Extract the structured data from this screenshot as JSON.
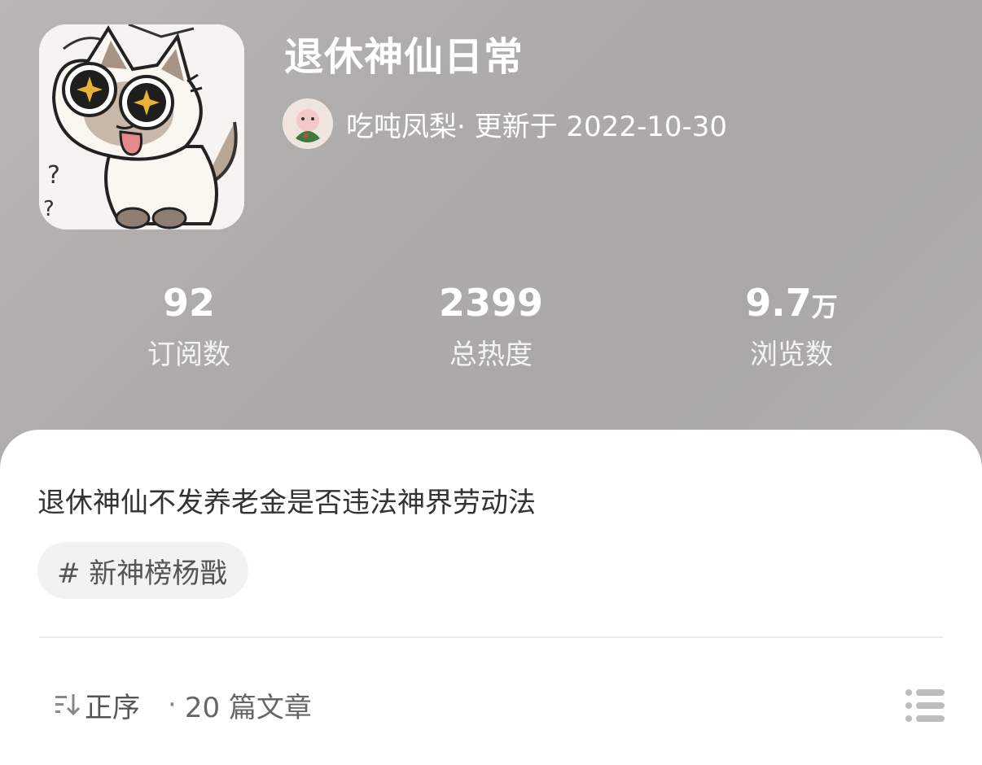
{
  "header": {
    "title": "退休神仙日常",
    "author": "吃吨凤梨",
    "update_text": "· 更新于 2022-10-30"
  },
  "stats": [
    {
      "value": "92",
      "unit": "",
      "label": "订阅数"
    },
    {
      "value": "2399",
      "unit": "",
      "label": "总热度"
    },
    {
      "value": "9.7",
      "unit": "万",
      "label": "浏览数"
    }
  ],
  "description": "退休神仙不发养老金是否违法神界劳动法",
  "tag": "# 新神榜杨戬",
  "footer": {
    "sort_label": "正序",
    "count_text": "20 篇文章",
    "dot": "·"
  },
  "icons": {
    "cover": "cat-cover-image",
    "avatar": "avatar-image",
    "sort": "sort-icon",
    "list": "list-icon"
  }
}
